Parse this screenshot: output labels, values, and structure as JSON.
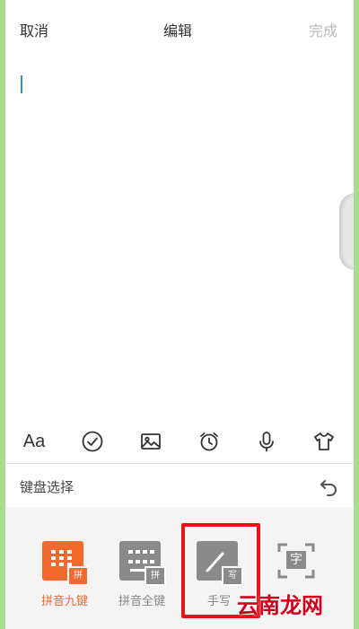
{
  "header": {
    "cancel_label": "取消",
    "title": "编辑",
    "done_label": "完成"
  },
  "toolbar": {
    "items": [
      "font-size",
      "checklist",
      "image",
      "alarm",
      "voice",
      "theme"
    ],
    "font_label": "Aa"
  },
  "keyboard_select": {
    "label": "键盘选择"
  },
  "keyboards": [
    {
      "label": "拼音九键",
      "tag": "拼",
      "active": true
    },
    {
      "label": "拼音全键",
      "tag": "拼",
      "active": false
    },
    {
      "label": "手写",
      "tag": "写",
      "active": false
    },
    {
      "label": "",
      "glyph": "字",
      "active": false
    }
  ],
  "colors": {
    "accent": "#f26a2e",
    "inactive_icon": "#8a8a8a",
    "highlight_box": "#e8141b",
    "frame": "#a6de8e"
  },
  "watermark": "云南龙网"
}
